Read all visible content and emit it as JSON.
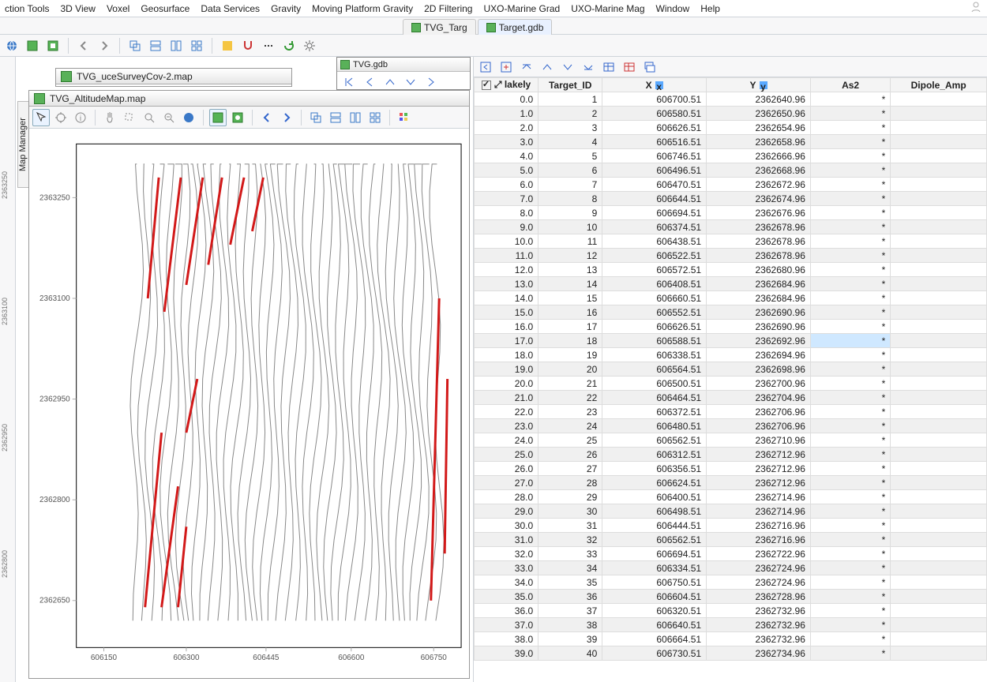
{
  "menu": [
    "ction Tools",
    "3D View",
    "Voxel",
    "Geosurface",
    "Data Services",
    "Gravity",
    "Moving Platform Gravity",
    "2D Filtering",
    "UXO-Marine Grad",
    "UXO-Marine Mag",
    "Window",
    "Help"
  ],
  "doc_tabs": [
    {
      "label": "TVG_Targ",
      "active": false
    },
    {
      "label": "Target.gdb",
      "active": true
    }
  ],
  "float_gdb_title": "TVG.gdb",
  "map_back_title": "TVG_uceSurveyCov-2.map",
  "map_front_title": "TVG_AltitudeMap.map",
  "vtab_label": "Map Manager",
  "leftstrip_ticks": [
    "2363250",
    "2363100",
    "2362950",
    "2362800"
  ],
  "table": {
    "headers": [
      "lakely",
      "Target_ID",
      "X",
      "Y",
      "As2",
      "Dipole_Amp"
    ],
    "x_marked": true,
    "y_marked": true,
    "rows": [
      [
        "0.0",
        1,
        "606700.51",
        "2362640.96",
        "*",
        ""
      ],
      [
        "1.0",
        2,
        "606580.51",
        "2362650.96",
        "*",
        ""
      ],
      [
        "2.0",
        3,
        "606626.51",
        "2362654.96",
        "*",
        ""
      ],
      [
        "3.0",
        4,
        "606516.51",
        "2362658.96",
        "*",
        ""
      ],
      [
        "4.0",
        5,
        "606746.51",
        "2362666.96",
        "*",
        ""
      ],
      [
        "5.0",
        6,
        "606496.51",
        "2362668.96",
        "*",
        ""
      ],
      [
        "6.0",
        7,
        "606470.51",
        "2362672.96",
        "*",
        ""
      ],
      [
        "7.0",
        8,
        "606644.51",
        "2362674.96",
        "*",
        ""
      ],
      [
        "8.0",
        9,
        "606694.51",
        "2362676.96",
        "*",
        ""
      ],
      [
        "9.0",
        10,
        "606374.51",
        "2362678.96",
        "*",
        ""
      ],
      [
        "10.0",
        11,
        "606438.51",
        "2362678.96",
        "*",
        ""
      ],
      [
        "11.0",
        12,
        "606522.51",
        "2362678.96",
        "*",
        ""
      ],
      [
        "12.0",
        13,
        "606572.51",
        "2362680.96",
        "*",
        ""
      ],
      [
        "13.0",
        14,
        "606408.51",
        "2362684.96",
        "*",
        ""
      ],
      [
        "14.0",
        15,
        "606660.51",
        "2362684.96",
        "*",
        ""
      ],
      [
        "15.0",
        16,
        "606552.51",
        "2362690.96",
        "*",
        ""
      ],
      [
        "16.0",
        17,
        "606626.51",
        "2362690.96",
        "*",
        ""
      ],
      [
        "17.0",
        18,
        "606588.51",
        "2362692.96",
        "*",
        ""
      ],
      [
        "18.0",
        19,
        "606338.51",
        "2362694.96",
        "*",
        ""
      ],
      [
        "19.0",
        20,
        "606564.51",
        "2362698.96",
        "*",
        ""
      ],
      [
        "20.0",
        21,
        "606500.51",
        "2362700.96",
        "*",
        ""
      ],
      [
        "21.0",
        22,
        "606464.51",
        "2362704.96",
        "*",
        ""
      ],
      [
        "22.0",
        23,
        "606372.51",
        "2362706.96",
        "*",
        ""
      ],
      [
        "23.0",
        24,
        "606480.51",
        "2362706.96",
        "*",
        ""
      ],
      [
        "24.0",
        25,
        "606562.51",
        "2362710.96",
        "*",
        ""
      ],
      [
        "25.0",
        26,
        "606312.51",
        "2362712.96",
        "*",
        ""
      ],
      [
        "26.0",
        27,
        "606356.51",
        "2362712.96",
        "*",
        ""
      ],
      [
        "27.0",
        28,
        "606624.51",
        "2362712.96",
        "*",
        ""
      ],
      [
        "28.0",
        29,
        "606400.51",
        "2362714.96",
        "*",
        ""
      ],
      [
        "29.0",
        30,
        "606498.51",
        "2362714.96",
        "*",
        ""
      ],
      [
        "30.0",
        31,
        "606444.51",
        "2362716.96",
        "*",
        ""
      ],
      [
        "31.0",
        32,
        "606562.51",
        "2362716.96",
        "*",
        ""
      ],
      [
        "32.0",
        33,
        "606694.51",
        "2362722.96",
        "*",
        ""
      ],
      [
        "33.0",
        34,
        "606334.51",
        "2362724.96",
        "*",
        ""
      ],
      [
        "34.0",
        35,
        "606750.51",
        "2362724.96",
        "*",
        ""
      ],
      [
        "35.0",
        36,
        "606604.51",
        "2362728.96",
        "*",
        ""
      ],
      [
        "36.0",
        37,
        "606320.51",
        "2362732.96",
        "*",
        ""
      ],
      [
        "37.0",
        38,
        "606640.51",
        "2362732.96",
        "*",
        ""
      ],
      [
        "38.0",
        39,
        "606664.51",
        "2362732.96",
        "*",
        ""
      ],
      [
        "39.0",
        40,
        "606730.51",
        "2362734.96",
        "*",
        ""
      ]
    ],
    "selected_row_index": 17
  },
  "chart_data": {
    "type": "line",
    "title": "",
    "xlabel": "",
    "ylabel": "",
    "xlim": [
      606100,
      606800
    ],
    "ylim": [
      2362580,
      2363330
    ],
    "xticks": [
      606150,
      606300,
      606445,
      606600,
      606750
    ],
    "yticks": [
      2362650,
      2362800,
      2362950,
      2363100,
      2363250
    ],
    "series_note": "~40 near-vertical survey flight lines spanning x≈606200..606770, y≈2362600..2363300; red segments denote flagged altitude deviations concentrated top-left (x≈606220..606440, y≈2363080..2363280), left edge mid/low (x≈606220..606300, y≈2362620..2362960), and right edge band (x≈606740..606770, y≈2362650..2363100)"
  }
}
